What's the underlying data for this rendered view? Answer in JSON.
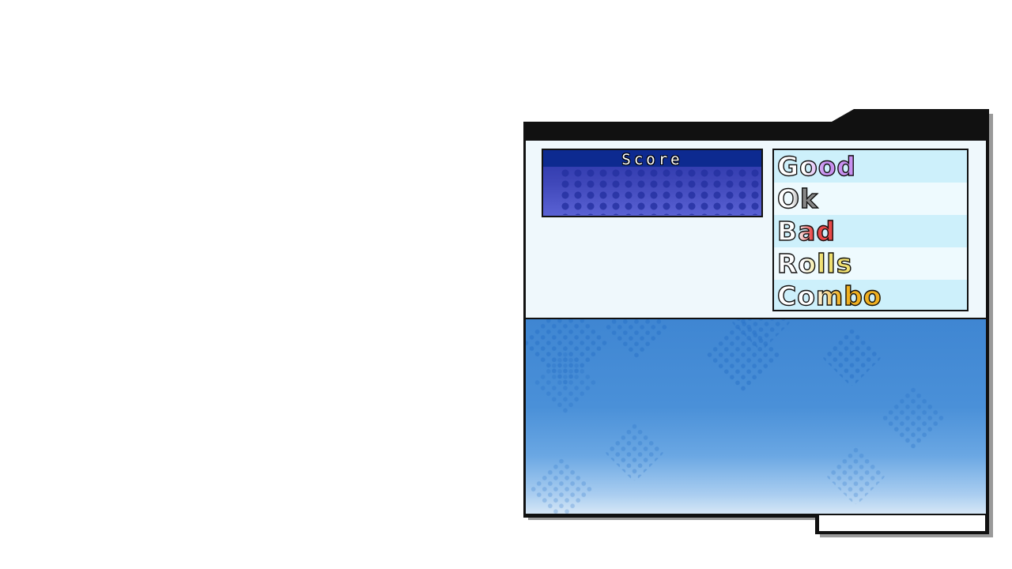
{
  "score": {
    "label": "Score"
  },
  "judgements": [
    {
      "label": "Good",
      "color": "#c890f0"
    },
    {
      "label": "Ok",
      "color": "#888888"
    },
    {
      "label": "Bad",
      "color": "#e84848"
    },
    {
      "label": "Rolls",
      "color": "#f0e070"
    },
    {
      "label": "Combo",
      "color": "#f0b020"
    }
  ],
  "colors": {
    "frame": "#111111",
    "panel_bg": "#eff8fc",
    "score_header": "#0d2a90",
    "field_top": "#3f86d2",
    "field_bottom": "#d6e7f6"
  }
}
